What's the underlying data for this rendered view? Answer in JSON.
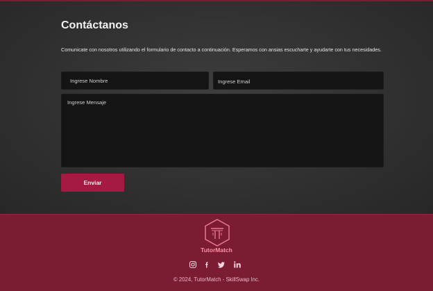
{
  "contact": {
    "title": "Contáctanos",
    "description": "Comunicate con nosotros utilizando el formulario de contacto a continuación. Esperamos con ansias escucharte y ayudarte con tus necesidades.",
    "name_placeholder": "Ingrese Nombre",
    "email_placeholder": "Ingrese Email",
    "message_placeholder": "Ingrese Mensaje",
    "send_label": "Enviar"
  },
  "footer": {
    "brand": "TutorMatch",
    "social_icons": [
      "instagram-icon",
      "facebook-icon",
      "twitter-icon",
      "linkedin-icon"
    ],
    "copyright": "© 2024, TutorMatch - SkillSwap Inc."
  },
  "colors": {
    "accent": "#a41a43",
    "footer_bg": "#7b1c33",
    "brand_pink": "#ff8fa3"
  }
}
